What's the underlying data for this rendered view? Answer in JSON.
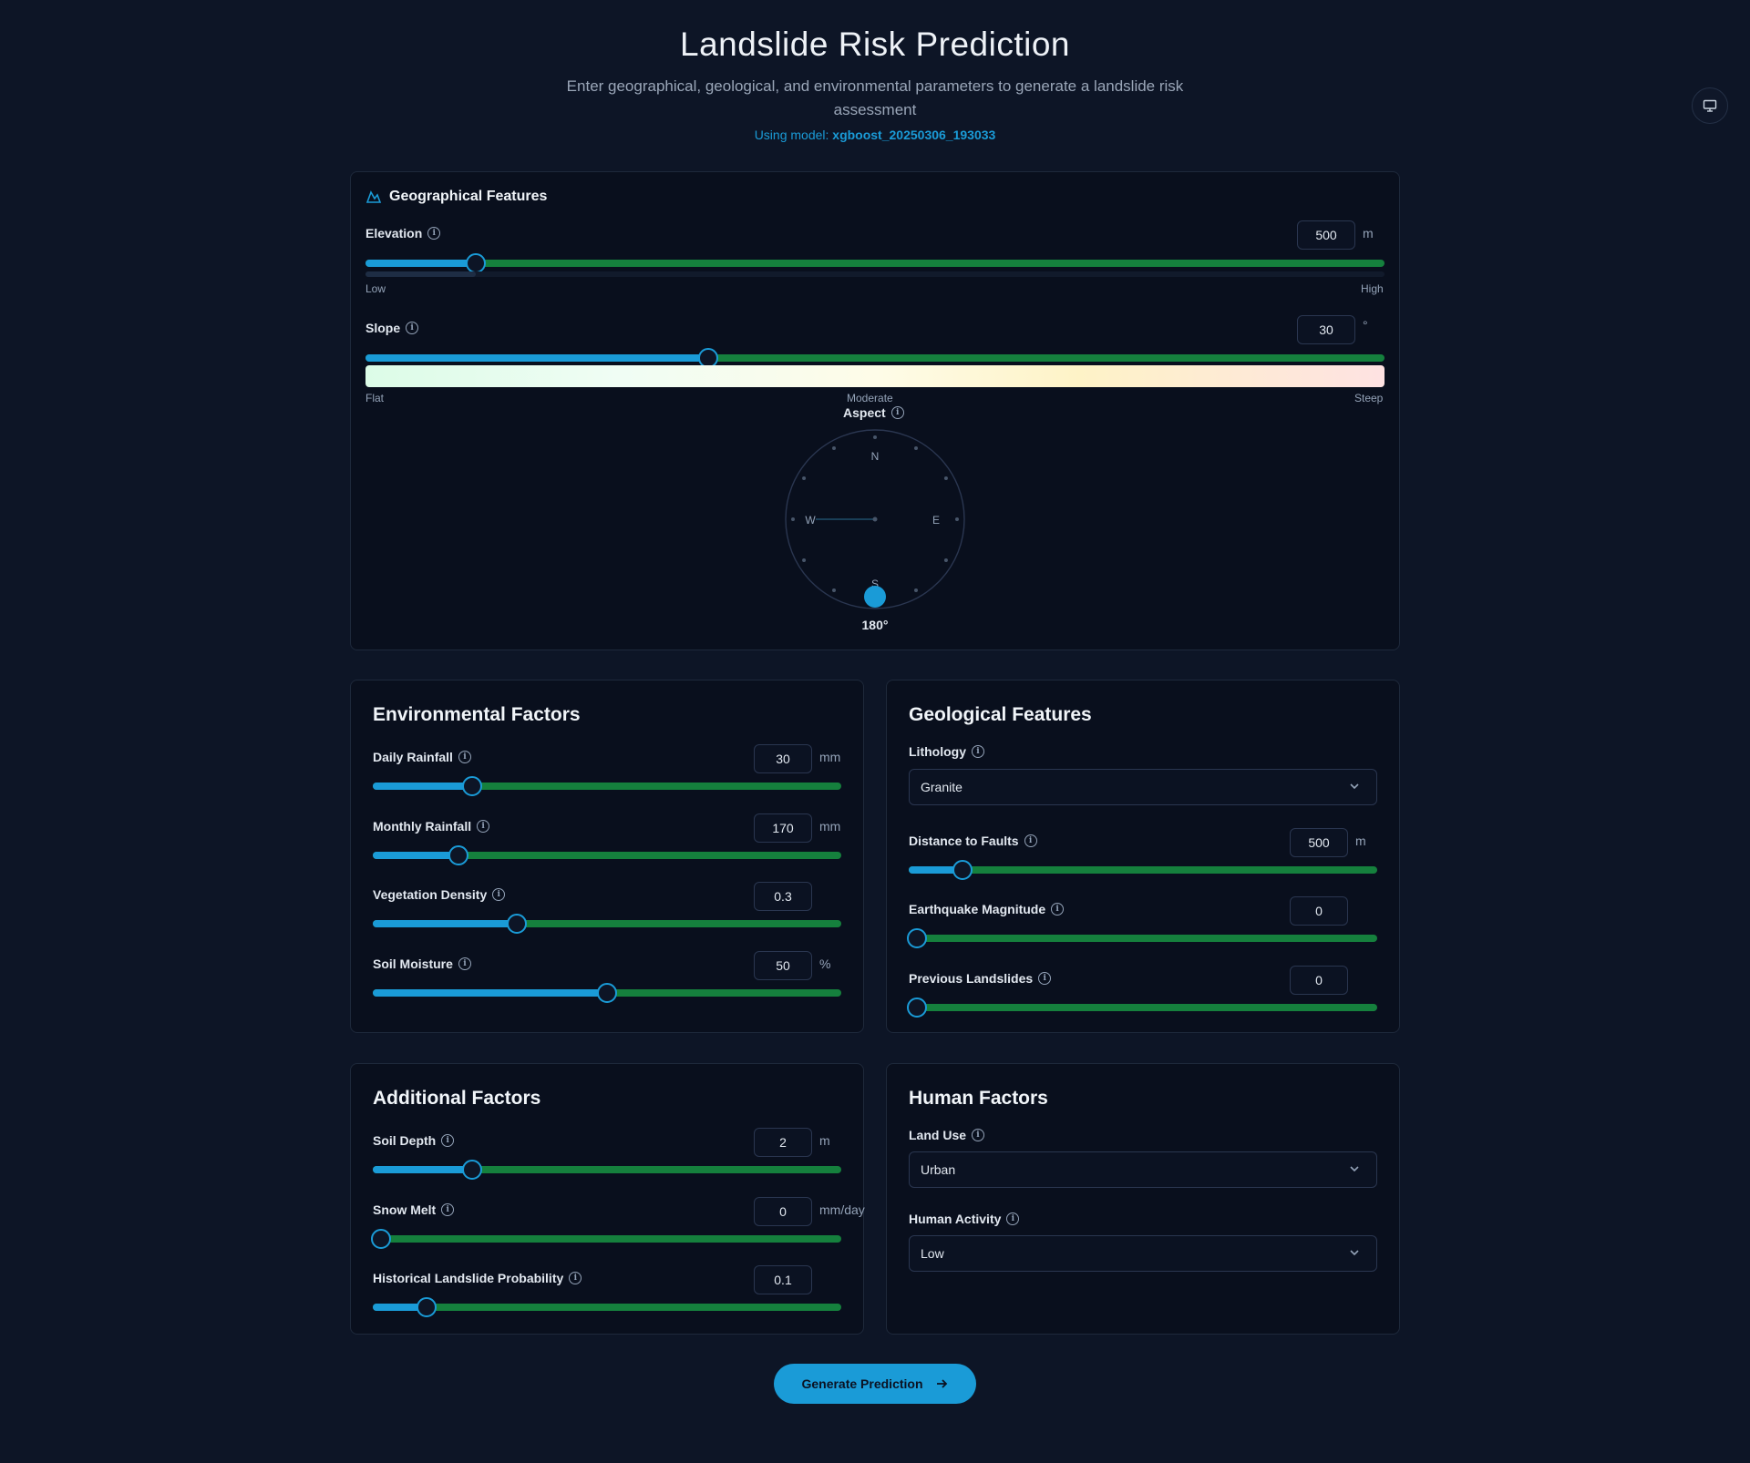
{
  "header": {
    "title": "Landslide Risk Prediction",
    "subtitle": "Enter geographical, geological, and environmental parameters to generate a landslide risk assessment",
    "model_prefix": "Using model:",
    "model_name": "xgboost_20250306_193033"
  },
  "geo": {
    "title": "Geographical Features",
    "elevation": {
      "label": "Elevation",
      "value": "500",
      "unit": "m",
      "low": "Low",
      "high": "High",
      "level": 0.108
    },
    "slope": {
      "label": "Slope",
      "value": "30",
      "unit": "°",
      "flat": "Flat",
      "moderate": "Moderate",
      "steep": "Steep",
      "level": 0.336
    },
    "aspect": {
      "label": "Aspect",
      "value": "180°",
      "n": "N",
      "e": "E",
      "s": "S",
      "w": "W",
      "degrees": 180
    }
  },
  "env": {
    "title": "Environmental Factors",
    "daily_rainfall": {
      "label": "Daily Rainfall",
      "value": "30",
      "unit": "mm",
      "level": 0.213
    },
    "monthly_rainfall": {
      "label": "Monthly Rainfall",
      "value": "170",
      "unit": "mm",
      "level": 0.183
    },
    "vegetation": {
      "label": "Vegetation Density",
      "value": "0.3",
      "unit": "",
      "level": 0.307
    },
    "soil_moisture": {
      "label": "Soil Moisture",
      "value": "50",
      "unit": "%",
      "level": 0.5
    }
  },
  "geol": {
    "title": "Geological Features",
    "lithology": {
      "label": "Lithology",
      "value": "Granite"
    },
    "faults": {
      "label": "Distance to Faults",
      "value": "500",
      "unit": "m",
      "level": 0.114
    },
    "earthquake": {
      "label": "Earthquake Magnitude",
      "value": "0",
      "level": 0
    },
    "prev_landslides": {
      "label": "Previous Landslides",
      "value": "0",
      "level": 0
    }
  },
  "additional": {
    "title": "Additional Factors",
    "soil_depth": {
      "label": "Soil Depth",
      "value": "2",
      "unit": "m",
      "level": 0.213
    },
    "snow_melt": {
      "label": "Snow Melt",
      "value": "0",
      "unit": "mm/day",
      "level": 0
    },
    "hist_prob": {
      "label": "Historical Landslide Probability",
      "value": "0.1",
      "level": 0.114
    }
  },
  "human": {
    "title": "Human Factors",
    "land_use": {
      "label": "Land Use",
      "value": "Urban"
    },
    "activity": {
      "label": "Human Activity",
      "value": "Low"
    }
  },
  "actions": {
    "generate": "Generate Prediction"
  },
  "colors": {
    "accent": "#1a9bd7",
    "track": "#15803d",
    "background": "#0d1526",
    "card": "#090f1d"
  },
  "icons": {
    "geo": "mountain-icon",
    "monitor": "monitor-icon",
    "info": "info-icon",
    "chevron": "chevron-down-icon",
    "arrow": "arrow-right-icon"
  }
}
